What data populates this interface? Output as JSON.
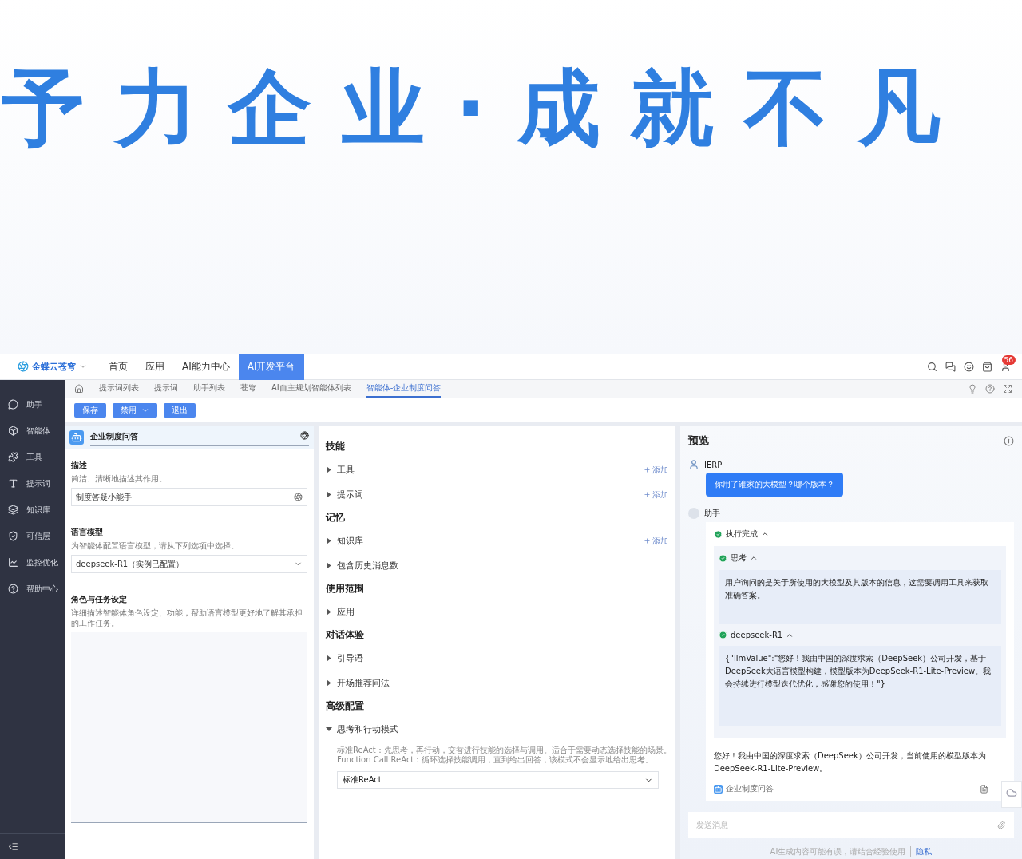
{
  "banner": {
    "text": "予力企业·成就不凡"
  },
  "top_nav": {
    "logo": "金蝶云苍穹",
    "items": [
      {
        "label": "首页",
        "selected": false
      },
      {
        "label": "应用",
        "selected": false
      },
      {
        "label": "AI能力中心",
        "selected": false
      },
      {
        "label": "AI开发平台",
        "selected": true
      }
    ],
    "notification_count": "56"
  },
  "breadcrumbs": [
    {
      "label": "提示词列表",
      "selected": false
    },
    {
      "label": "提示词",
      "selected": false
    },
    {
      "label": "助手列表",
      "selected": false
    },
    {
      "label": "苍穹",
      "selected": false
    },
    {
      "label": "AI自主规划智能体列表",
      "selected": false
    },
    {
      "label": "智能体-企业制度问答",
      "selected": true
    }
  ],
  "toolbar": {
    "buttons": [
      {
        "label": "保存",
        "kind": "plain"
      },
      {
        "label": "禁用",
        "kind": "dropdown"
      },
      {
        "label": "退出",
        "kind": "plain"
      }
    ]
  },
  "sidebar": {
    "items": [
      {
        "label": "助手"
      },
      {
        "label": "智能体"
      },
      {
        "label": "工具"
      },
      {
        "label": "提示词"
      },
      {
        "label": "知识库"
      },
      {
        "label": "可信层"
      },
      {
        "label": "监控优化"
      },
      {
        "label": "帮助中心"
      }
    ]
  },
  "settings": {
    "agent_name": "企业制度问答",
    "description": {
      "title": "描述",
      "hint": "简洁、清晰地描述其作用。",
      "value": "制度答疑小能手"
    },
    "language_model": {
      "title": "语言模型",
      "hint": "为智能体配置语言模型，请从下列选项中选择。",
      "value": "deepseek-R1（实例已配置）"
    },
    "role": {
      "title": "角色与任务设定",
      "hint": "详细描述智能体角色设定、功能，帮助语言模型更好地了解其承担的工作任务。"
    }
  },
  "skills": {
    "groups": [
      {
        "title": "技能",
        "items": [
          {
            "label": "工具",
            "expanded": false,
            "action": "添加"
          },
          {
            "label": "提示词",
            "expanded": false,
            "action": "添加"
          }
        ]
      },
      {
        "title": "记忆",
        "items": [
          {
            "label": "知识库",
            "expanded": false,
            "action": "添加"
          },
          {
            "label": "包含历史消息数",
            "expanded": false
          }
        ]
      },
      {
        "title": "使用范围",
        "items": [
          {
            "label": "应用",
            "expanded": false
          }
        ]
      },
      {
        "title": "对话体验",
        "items": [
          {
            "label": "引导语",
            "expanded": false
          },
          {
            "label": "开场推荐问法",
            "expanded": false
          }
        ]
      },
      {
        "title": "高级配置",
        "items": [
          {
            "label": "思考和行动模式",
            "expanded": true,
            "notes": [
              "标准ReAct：先思考，再行动，交替进行技能的选择与调用。适合于需要动态选择技能的场景。",
              "Function Call ReAct：循环选择技能调用，直到给出回答，该模式不会显示地给出思考。"
            ],
            "value": "标准ReAct"
          }
        ]
      }
    ]
  },
  "preview": {
    "title": "预览",
    "user_name": "IERP",
    "user_message": "你用了谁家的大模型？哪个版本？",
    "assistant_name": "助手",
    "run": {
      "label": "执行完成",
      "expanded": true,
      "steps": [
        {
          "label": "思考",
          "expanded": true,
          "text": "用户询问的是关于所使用的大模型及其版本的信息，这需要调用工具来获取准确答案。"
        },
        {
          "label": "deepseek-R1",
          "expanded": true,
          "text": "{\"llmValue\":\"您好！我由中国的深度求索（DeepSeek）公司开发，基于DeepSeek大语言模型构建，模型版本为DeepSeek-R1-Lite-Preview。我会持续进行模型迭代优化，感谢您的使用！\"}"
        }
      ]
    },
    "answer": "您好！我由中国的深度求索（DeepSeek）公司开发，当前使用的模型版本为DeepSeek-R1-Lite-Preview。",
    "agent_tag": "企业制度问答",
    "input_placeholder": "发送消息",
    "disclaimer": "AI生成内容可能有误，请结合经验使用",
    "link": "隐私"
  }
}
